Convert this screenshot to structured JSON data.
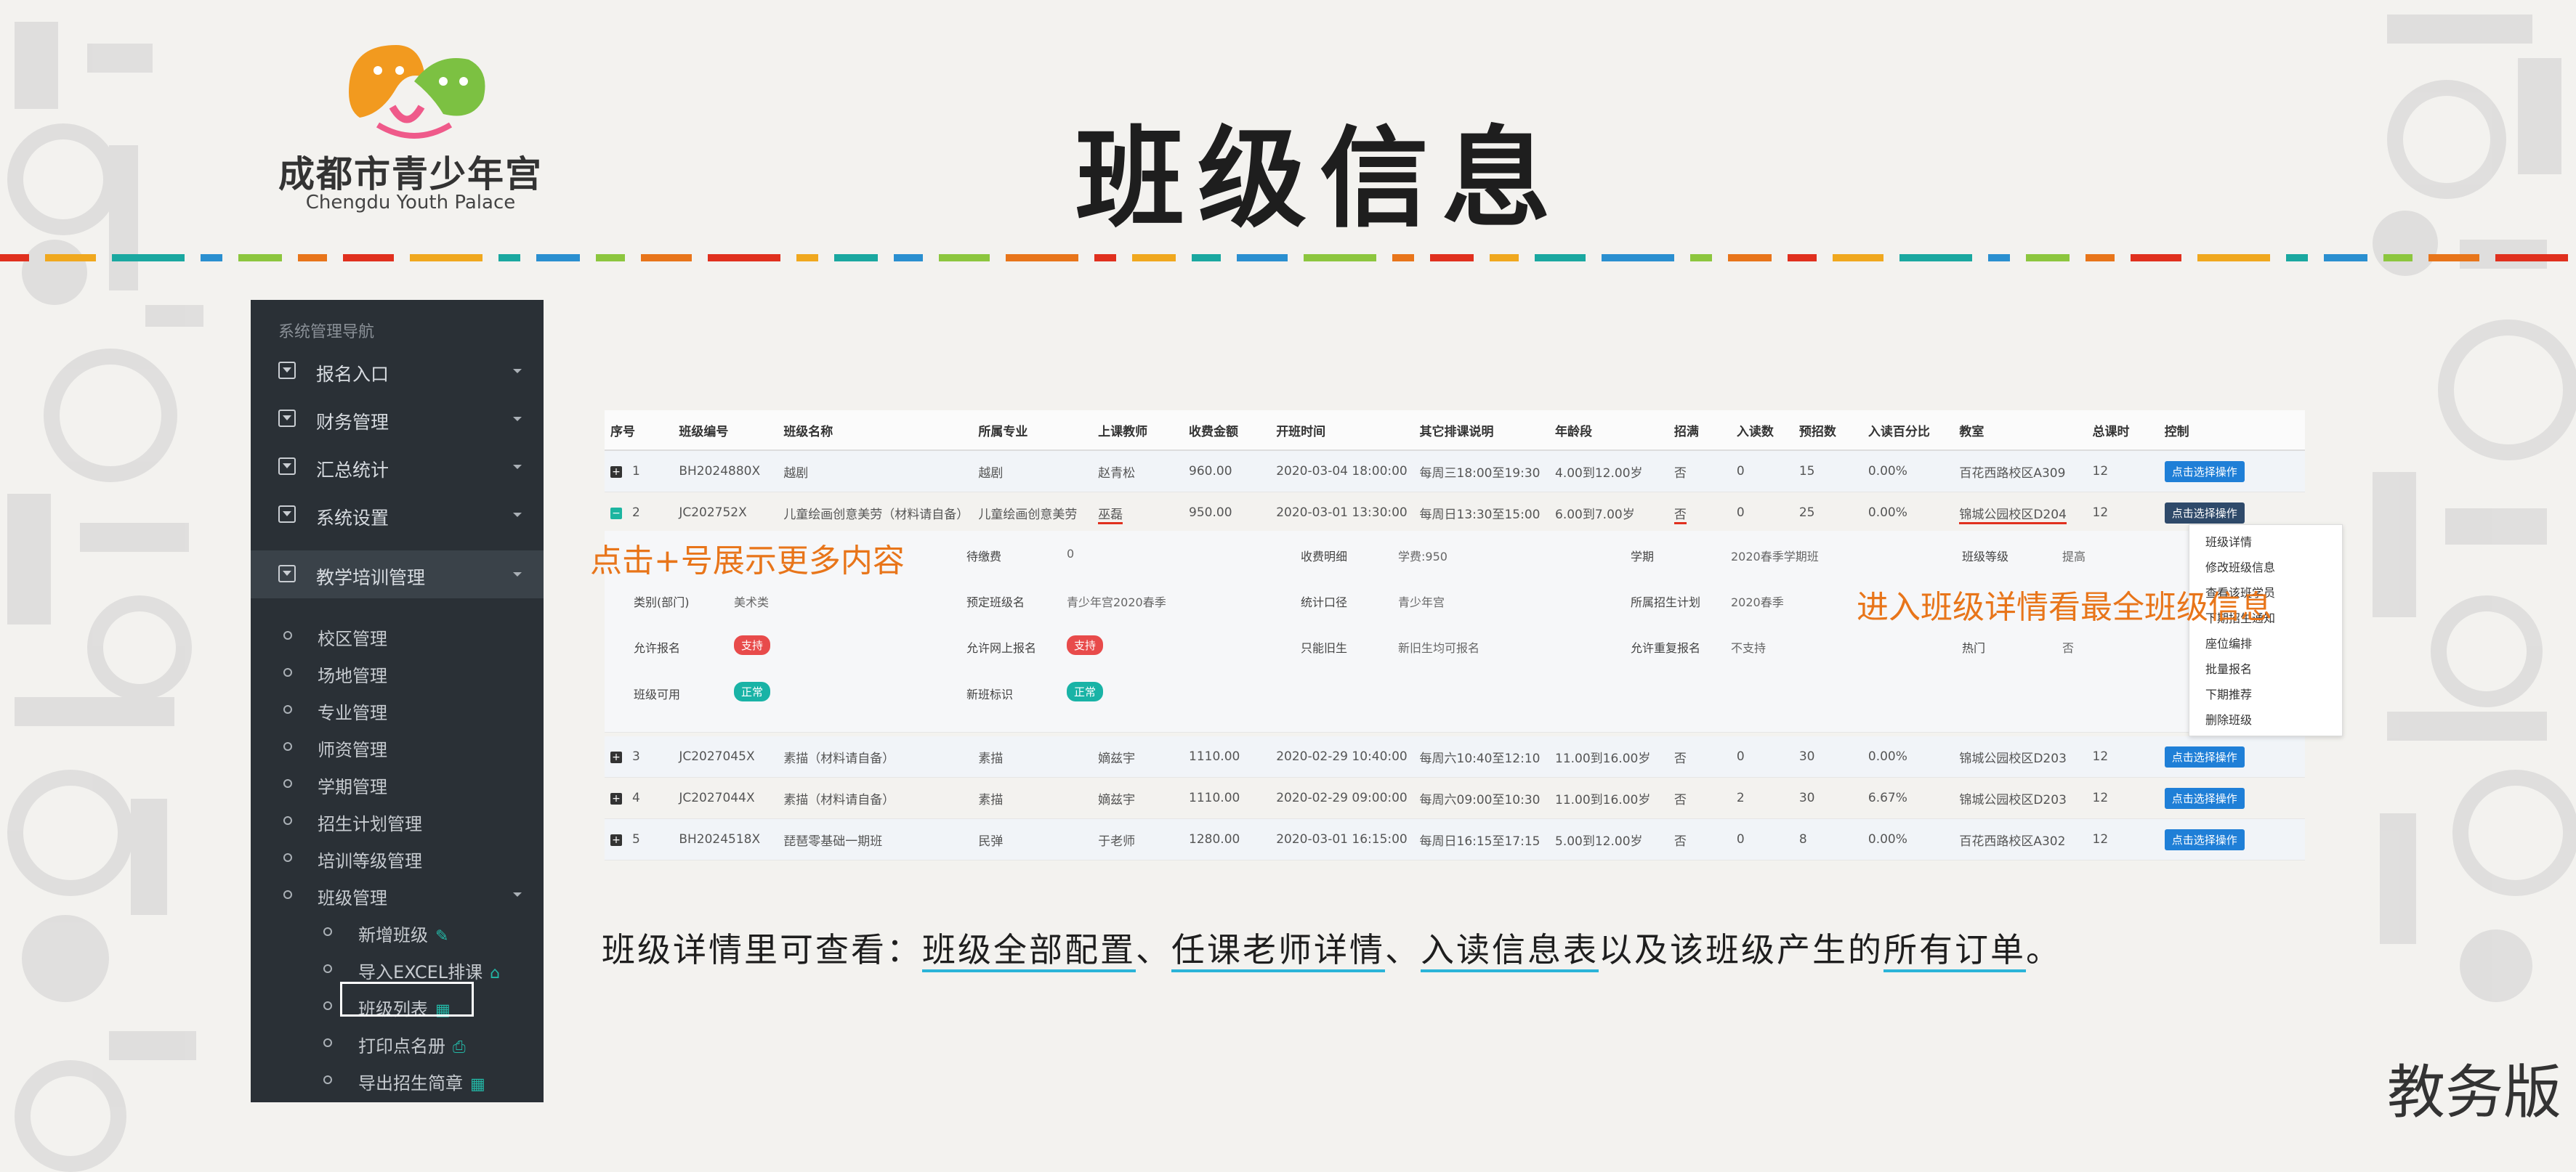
{
  "logo": {
    "name": "成都市青少年宫",
    "english": "Chengdu Youth Palace"
  },
  "title": "班级信息",
  "sidebar": {
    "header": "系统管理导航",
    "items": [
      {
        "label": "报名入口"
      },
      {
        "label": "财务管理"
      },
      {
        "label": "汇总统计"
      },
      {
        "label": "系统设置"
      },
      {
        "label": "教学培训管理"
      }
    ],
    "sub_items": [
      {
        "label": "校区管理"
      },
      {
        "label": "场地管理"
      },
      {
        "label": "专业管理"
      },
      {
        "label": "师资管理"
      },
      {
        "label": "学期管理"
      },
      {
        "label": "招生计划管理"
      },
      {
        "label": "培训等级管理"
      },
      {
        "label": "班级管理"
      }
    ],
    "class_items": [
      {
        "label": "新增班级"
      },
      {
        "label": "导入EXCEL排课"
      },
      {
        "label": "班级列表"
      },
      {
        "label": "打印点名册"
      },
      {
        "label": "导出招生简章"
      }
    ]
  },
  "table": {
    "headers": [
      "序号",
      "班级编号",
      "班级名称",
      "所属专业",
      "上课教师",
      "收费金额",
      "开班时间",
      "其它排课说明",
      "年龄段",
      "招满",
      "入读数",
      "预招数",
      "入读百分比",
      "教室",
      "总课时",
      "控制"
    ],
    "rows": [
      [
        "1",
        "BH2024880X",
        "越剧",
        "越剧",
        "赵青松",
        "960.00",
        "2020-03-04 18:00:00",
        "每周三18:00至19:30",
        "4.00到12.00岁",
        "否",
        "0",
        "15",
        "0.00%",
        "百花西路校区A309",
        "12",
        "点击选择操作"
      ],
      [
        "2",
        "JC202752X",
        "儿童绘画创意美劳（材料请自备）",
        "儿童绘画创意美劳",
        "巫磊",
        "950.00",
        "2020-03-01 13:30:00",
        "每周日13:30至15:00",
        "6.00到7.00岁",
        "否",
        "0",
        "25",
        "0.00%",
        "锦城公园校区D204",
        "12",
        "点击选择操作"
      ],
      [
        "3",
        "JC2027045X",
        "素描（材料请自备）",
        "素描",
        "嫡兹宇",
        "1110.00",
        "2020-02-29 10:40:00",
        "每周六10:40至12:10",
        "11.00到16.00岁",
        "否",
        "0",
        "30",
        "0.00%",
        "锦城公园校区D203",
        "12",
        "点击选择操作"
      ],
      [
        "4",
        "JC2027044X",
        "素描（材料请自备）",
        "素描",
        "嫡兹宇",
        "1110.00",
        "2020-02-29 09:00:00",
        "每周六09:00至10:30",
        "11.00到16.00岁",
        "否",
        "2",
        "30",
        "6.67%",
        "锦城公园校区D203",
        "12",
        "点击选择操作"
      ],
      [
        "5",
        "BH2024518X",
        "琵琶零基础一期班",
        "民弹",
        "于老师",
        "1280.00",
        "2020-03-01 16:15:00",
        "每周日16:15至17:15",
        "5.00到12.00岁",
        "否",
        "0",
        "8",
        "0.00%",
        "百花西路校区A302",
        "12",
        "点击选择操作"
      ]
    ]
  },
  "detail": {
    "row1": [
      {
        "label": "待缴费",
        "value": "0"
      },
      {
        "label": "收费明细",
        "value": "学费:950"
      },
      {
        "label": "学期",
        "value": "2020春季学期班"
      },
      {
        "label": "班级等级",
        "value": "提高"
      }
    ],
    "row2": [
      {
        "label": "类别(部门)",
        "value": "美术类"
      },
      {
        "label": "预定班级名",
        "value": "青少年宫2020春季"
      },
      {
        "label": "统计口径",
        "value": "青少年宫"
      },
      {
        "label": "所属招生计划",
        "value": "2020春季"
      }
    ],
    "row3": [
      {
        "label": "允许报名",
        "value": "支持"
      },
      {
        "label": "允许网上报名",
        "value": "支持"
      },
      {
        "label": "只能旧生",
        "value": "新旧生均可报名"
      },
      {
        "label": "允许重复报名",
        "value": "不支持"
      },
      {
        "label": "热门",
        "value": "否"
      }
    ],
    "row4": [
      {
        "label": "班级可用",
        "value": "正常"
      },
      {
        "label": "新班标识",
        "value": "正常"
      }
    ]
  },
  "menu": {
    "items": [
      "班级详情",
      "修改班级信息",
      "查看该班学员",
      "下期招生通知",
      "座位编排",
      "批量报名",
      "下期推荐",
      "删除班级"
    ]
  },
  "callouts": {
    "expand": "点击+号展示更多内容",
    "detail": "进入班级详情看最全班级信息"
  },
  "bottom_note": {
    "prefix": "班级详情里可查看：",
    "p1": "班级全部配置",
    "sep1": "、",
    "p2": "任课老师详情",
    "sep2": "、",
    "p3": "入读信息表",
    "mid": "以及该班级产生的",
    "p4": "所有订单",
    "end": "。"
  },
  "edition": "教务版",
  "colors": {
    "sidebar_bg": "#2a3036",
    "accent_orange": "#e8751a",
    "button_blue": "#1f7fd7",
    "teal": "#19b3a6",
    "red": "#e84b4b"
  }
}
